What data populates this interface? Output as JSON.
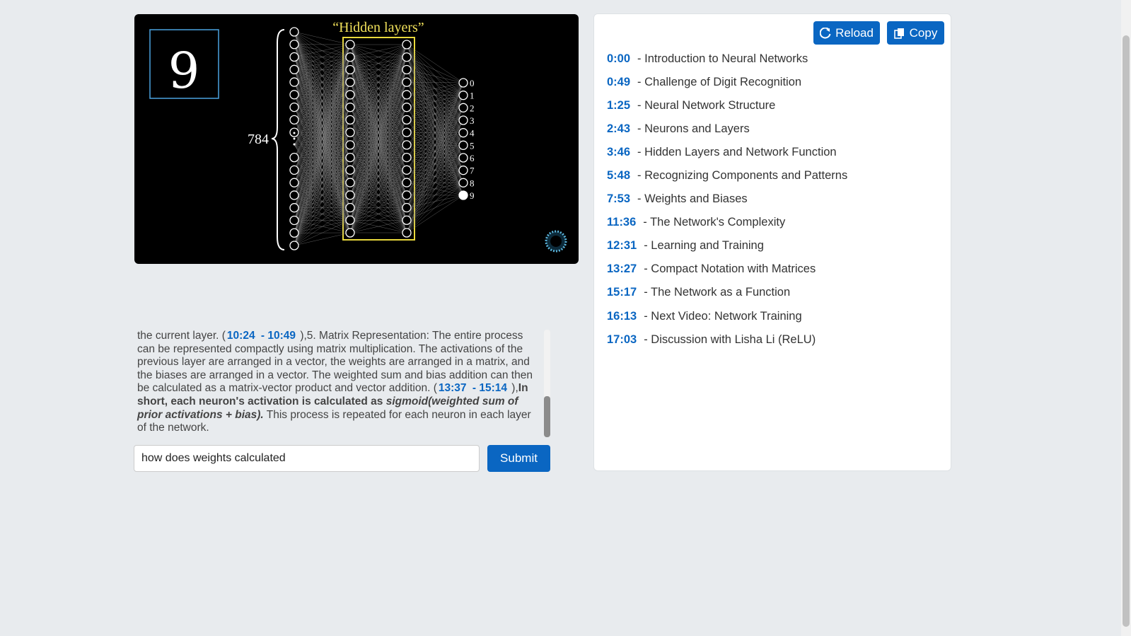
{
  "video": {
    "hidden_label": "“Hidden layers”",
    "input_count": "784",
    "input_digit": "9",
    "output_labels": [
      "0",
      "1",
      "2",
      "3",
      "4",
      "5",
      "6",
      "7",
      "8",
      "9"
    ]
  },
  "chat": {
    "part1": "the current layer. (",
    "ts1": "10:24",
    "ts2": "- 10:49",
    "part2": "),5. Matrix Representation: The entire process can be represented compactly using matrix multiplication. The activations of the previous layer are arranged in a vector, the weights are arranged in a matrix, and the biases are arranged in a vector. The weighted sum and bias addition can then be calculated as a matrix-vector product and vector addition. (",
    "ts3": "13:37",
    "ts4": "- 15:14",
    "part3": "),",
    "bold1": "In short, each neuron's activation is calculated as ",
    "bold_italic": "sigmoid(weighted sum of prior activations + bias).",
    "part4": " This process is repeated for each neuron in each layer of the network."
  },
  "query": {
    "value": "how does weights calculated"
  },
  "submit_label": "Submit",
  "toolbar": {
    "reload_label": "Reload",
    "copy_label": "Copy"
  },
  "chapters": [
    {
      "time": "0:00",
      "title": "- Introduction to Neural Networks"
    },
    {
      "time": "0:49",
      "title": "- Challenge of Digit Recognition"
    },
    {
      "time": "1:25",
      "title": "- Neural Network Structure"
    },
    {
      "time": "2:43",
      "title": "- Neurons and Layers"
    },
    {
      "time": "3:46",
      "title": "- Hidden Layers and Network Function"
    },
    {
      "time": "5:48",
      "title": "- Recognizing Components and Patterns"
    },
    {
      "time": "7:53",
      "title": "- Weights and Biases"
    },
    {
      "time": "11:36",
      "title": "- The Network's Complexity"
    },
    {
      "time": "12:31",
      "title": "- Learning and Training"
    },
    {
      "time": "13:27",
      "title": "- Compact Notation with Matrices"
    },
    {
      "time": "15:17",
      "title": "- The Network as a Function"
    },
    {
      "time": "16:13",
      "title": "- Next Video: Network Training"
    },
    {
      "time": "17:03",
      "title": "- Discussion with Lisha Li (ReLU)"
    }
  ]
}
